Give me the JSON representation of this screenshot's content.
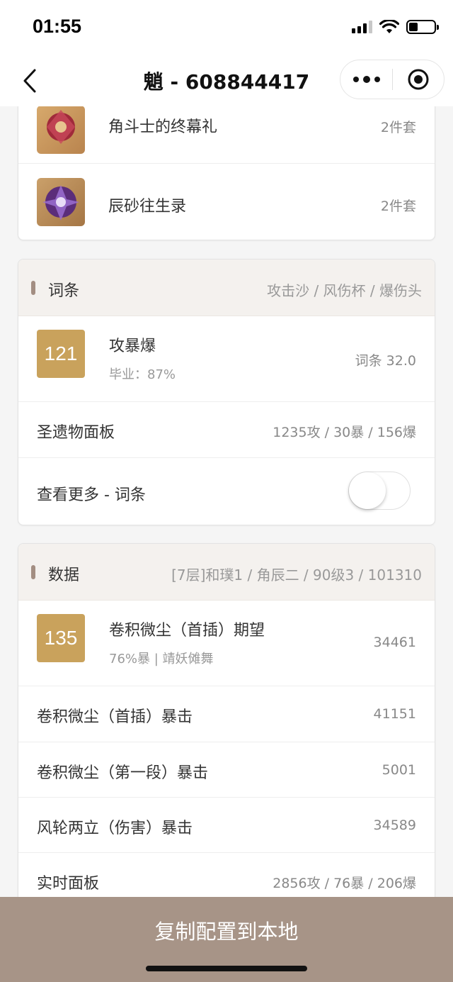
{
  "status": {
    "time": "01:55"
  },
  "nav": {
    "title": "魈 - 608844417"
  },
  "sets": {
    "items": [
      {
        "name": "角斗士的终幕礼",
        "count": "2件套"
      },
      {
        "name": "辰砂往生录",
        "count": "2件套"
      }
    ]
  },
  "substats": {
    "title": "词条",
    "summary": "攻击沙 / 风伤杯 / 爆伤头",
    "score": "121",
    "main": "攻暴爆",
    "sub": "毕业：87%",
    "value": "词条 32.0",
    "panel_label": "圣遗物面板",
    "panel_value": "1235攻 / 30暴 / 156爆",
    "more_label": "查看更多 - 词条",
    "more_enabled": false
  },
  "data": {
    "title": "数据",
    "summary": "[7层]和璞1 / 角辰二 / 90级3 / 101310",
    "score": "135",
    "main": "卷积微尘（首插）期望",
    "sub": "76%暴 | 靖妖傩舞",
    "value": "34461",
    "rows": [
      {
        "label": "卷积微尘（首插）暴击",
        "value": "41151"
      },
      {
        "label": "卷积微尘（第一段）暴击",
        "value": "5001"
      },
      {
        "label": "风轮两立（伤害）暴击",
        "value": "34589"
      },
      {
        "label": "实时面板",
        "value": "2856攻 / 76暴 / 206爆"
      }
    ]
  },
  "bottom": {
    "copy_label": "复制配置到本地"
  },
  "colors": {
    "accent": "#a79487",
    "score": "#c9a25c",
    "header_bg": "#f4f1ee"
  }
}
